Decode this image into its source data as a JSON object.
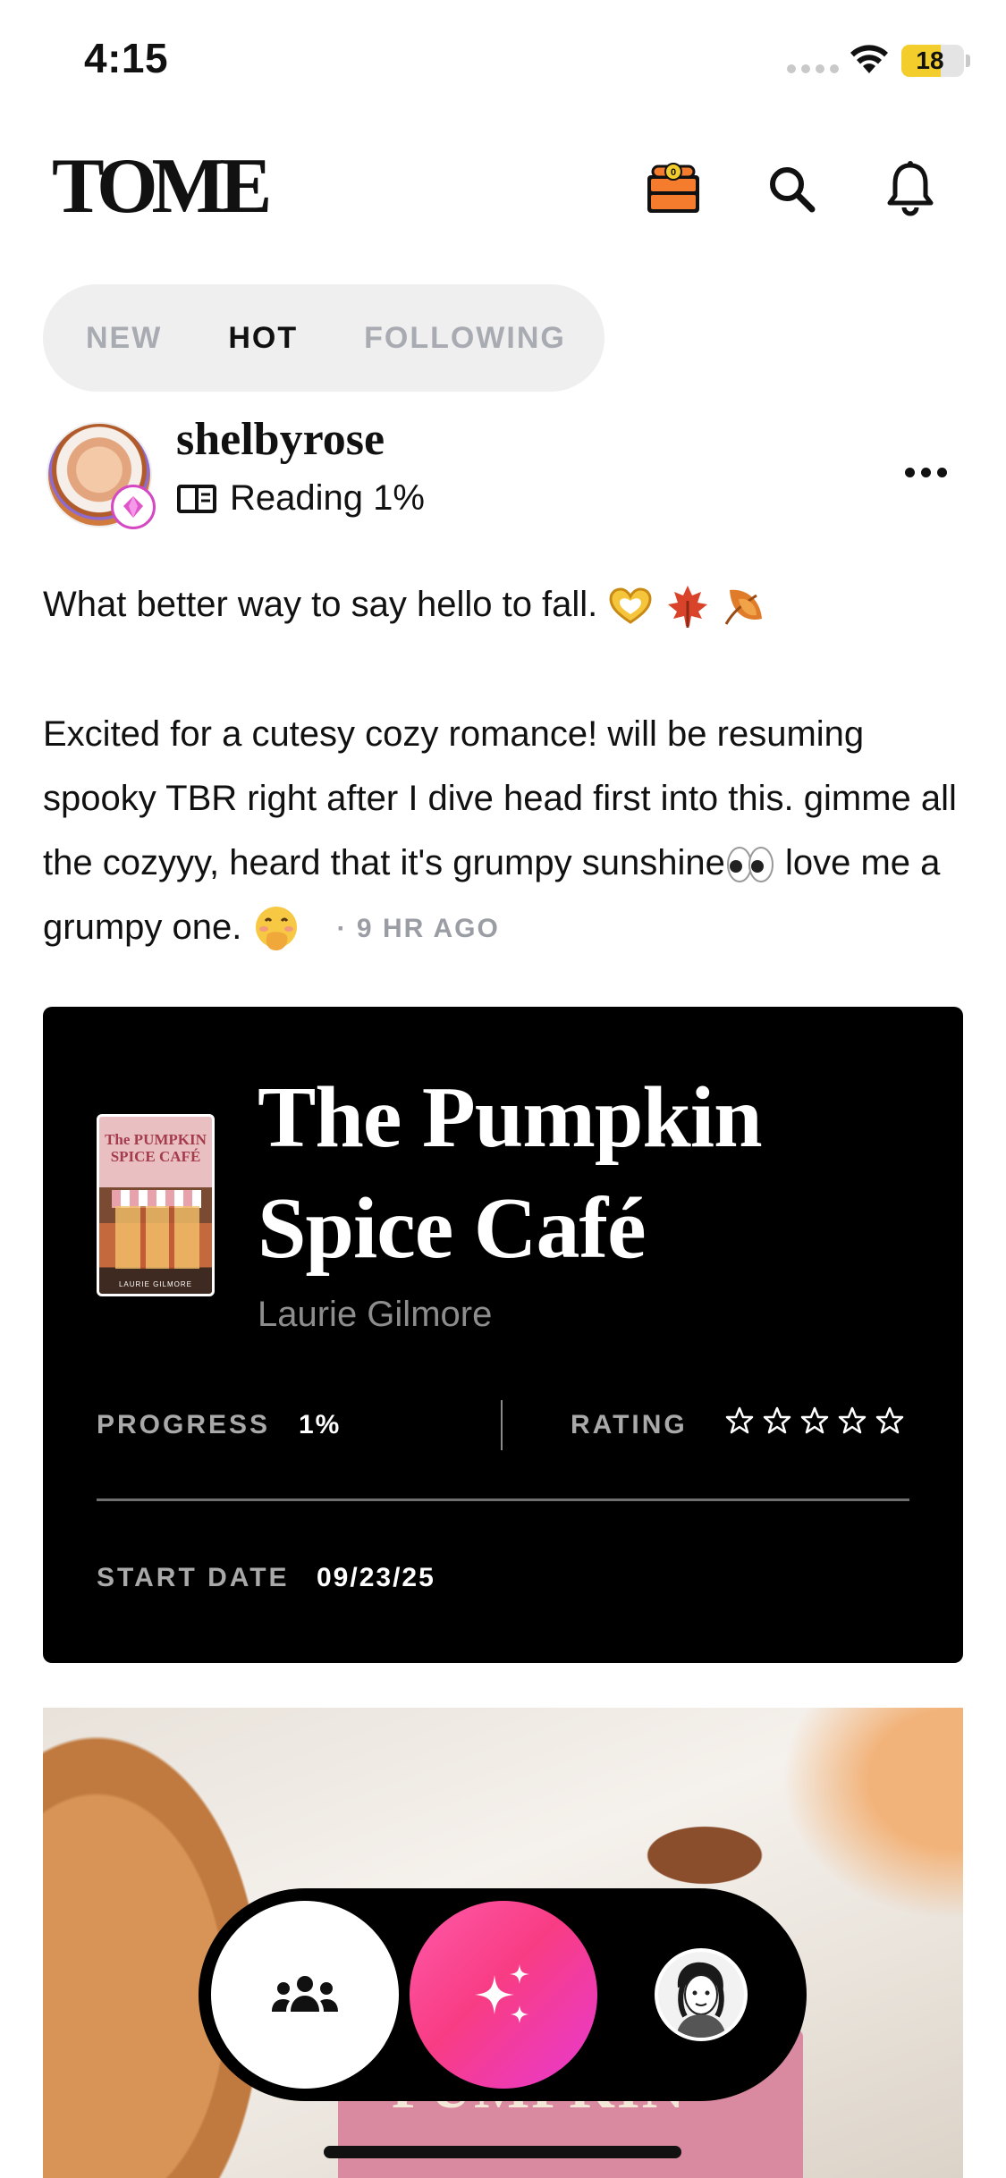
{
  "status_bar": {
    "time": "4:15",
    "battery_level": 18,
    "battery_label": "18",
    "icons": [
      "signal-icon",
      "wifi-icon",
      "battery-icon"
    ]
  },
  "header": {
    "logo": "TOME",
    "icons": [
      "treasure-chest-icon",
      "search-icon",
      "bell-icon"
    ],
    "chest_badge": "0"
  },
  "tabs": [
    {
      "label": "NEW",
      "active": false
    },
    {
      "label": "HOT",
      "active": true
    },
    {
      "label": "FOLLOWING",
      "active": false
    }
  ],
  "post": {
    "username": "shelbyrose",
    "status": "Reading 1%",
    "line1": "What better way to say hello to fall. ",
    "line1_emojis": [
      "heart-hands-emoji",
      "maple-leaf-emoji",
      "fallen-leaf-emoji"
    ],
    "line2a": "Excited for a cutesy cozy romance! will be resuming spooky TBR right after I dive head first into this. gimme all the cozyyy, heard that it's grumpy sunshine",
    "line2b": " love me a grumpy one.",
    "line2_emojis": [
      "eyes-emoji",
      "hand-over-mouth-emoji"
    ],
    "timestamp": "· 9 HR AGO"
  },
  "book_card": {
    "title_line1": "The Pumpkin",
    "title_line2": "Spice Café",
    "author": "Laurie Gilmore",
    "cover_title": "The PUMPKIN SPICE CAFÉ",
    "cover_author": "LAURIE GILMORE",
    "progress_label": "PROGRESS",
    "progress_value": "1%",
    "rating_label": "RATING",
    "rating_value": 0,
    "rating_max": 5,
    "start_label": "START DATE",
    "start_value": "09/23/25"
  },
  "photo": {
    "visible_text": "PUMPKIN"
  },
  "bottom_nav": {
    "items": [
      "community-icon",
      "sparkles-icon",
      "profile-avatar"
    ]
  },
  "colors": {
    "accent_pink": "#f83c84",
    "accent_magenta": "#e83ad0",
    "card_bg": "#000000",
    "tab_inactive": "#a8abb2"
  }
}
